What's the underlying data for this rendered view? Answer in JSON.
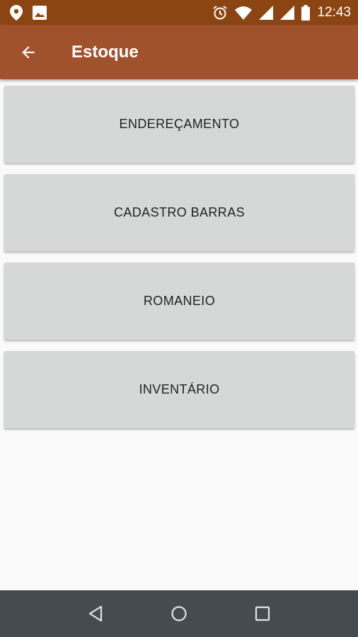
{
  "status_bar": {
    "time": "12:43",
    "icons": [
      "location-icon",
      "image-icon",
      "alarm-icon",
      "wifi-icon",
      "signal-icon",
      "signal-icon",
      "battery-icon"
    ]
  },
  "app_bar": {
    "title": "Estoque",
    "back_icon": "arrow-back-icon"
  },
  "menu": {
    "items": [
      {
        "label": "ENDEREÇAMENTO"
      },
      {
        "label": "CADASTRO BARRAS"
      },
      {
        "label": "ROMANEIO"
      },
      {
        "label": "INVENTÁRIO"
      }
    ]
  },
  "nav_bar": {
    "icons": [
      "back-triangle-icon",
      "home-circle-icon",
      "recents-square-icon"
    ]
  },
  "colors": {
    "status_bar": "#8b4513",
    "app_bar": "#a0522d",
    "button": "#d6d7d7",
    "background": "#fafafa",
    "nav_bar": "#454c50"
  }
}
